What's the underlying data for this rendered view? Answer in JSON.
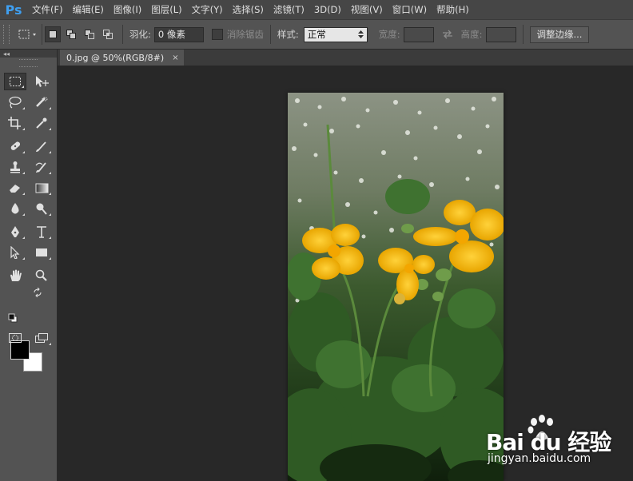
{
  "app": {
    "logo": "Ps"
  },
  "menu": [
    "文件(F)",
    "编辑(E)",
    "图像(I)",
    "图层(L)",
    "文字(Y)",
    "选择(S)",
    "滤镜(T)",
    "3D(D)",
    "视图(V)",
    "窗口(W)",
    "帮助(H)"
  ],
  "options": {
    "feather_label": "羽化:",
    "feather_value": "0 像素",
    "antialias_label": "消除锯齿",
    "style_label": "样式:",
    "style_value": "正常",
    "width_label": "宽度:",
    "height_label": "高度:",
    "refine_button": "调整边缘..."
  },
  "toolbox": {
    "collapse_glyph": "◂◂",
    "foreground_color": "#000000",
    "background_color": "#ffffff"
  },
  "document": {
    "tab_title": "0.jpg @ 50%(RGB/8#)",
    "close_glyph": "×"
  },
  "watermark": {
    "brand": "Bai du 经验",
    "url": "jingyan.baidu.com"
  },
  "colors": {
    "menubar_bg": "#464646",
    "panel_bg": "#535353",
    "canvas_bg": "#282828",
    "accent_logo": "#3f9ff0",
    "flower_yellow": "#f5b800"
  }
}
